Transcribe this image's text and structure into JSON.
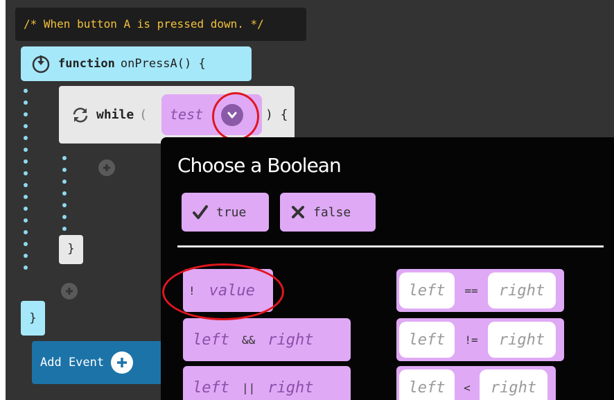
{
  "comment": "/* When button A is pressed down. */",
  "function_block": {
    "keyword": "function",
    "name": "onPressA() {",
    "close_brace": "}"
  },
  "while_block": {
    "keyword": "while",
    "open_paren": "(",
    "condition_placeholder": "test",
    "close": ") {",
    "close_brace": "}"
  },
  "add_event": {
    "label": "Add Event"
  },
  "popup": {
    "title": "Choose a Boolean",
    "true_label": "true",
    "false_label": "false",
    "not_block": {
      "operator": "!",
      "operand": "value"
    },
    "and_block": {
      "left": "left",
      "operator": "&&",
      "right": "right"
    },
    "or_block": {
      "left": "left",
      "operator": "||",
      "right": "right"
    },
    "eq_block": {
      "left": "left",
      "operator": "==",
      "right": "right"
    },
    "neq_block": {
      "left": "left",
      "operator": "!=",
      "right": "right"
    },
    "lt_block": {
      "left": "left",
      "operator": "<",
      "right": "right"
    }
  },
  "icons": [
    "power-icon",
    "refresh-icon",
    "chevron-down-icon",
    "plus-icon",
    "checkmark-icon",
    "x-icon"
  ],
  "colors": {
    "editor_bg": "#333333",
    "function_block": "#a5e8fa",
    "boolean_block": "#dfa9f5",
    "popup_bg": "#050505",
    "highlight_circle": "#e0161e",
    "add_event": "#1c73a8",
    "comment_text": "#f2c23c"
  }
}
